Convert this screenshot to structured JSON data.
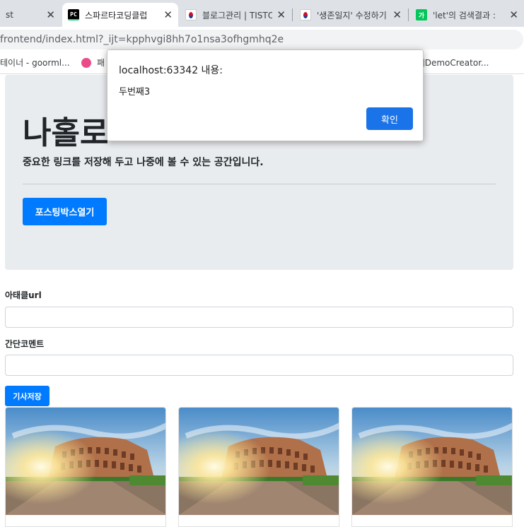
{
  "browser": {
    "tabs": [
      {
        "title": "st"
      },
      {
        "title": "스파르타코딩클럽"
      },
      {
        "title": "블로그관리 | TISTO"
      },
      {
        "title": "'생존일지' 수정하기"
      },
      {
        "title": "'let'의 검색결과 : "
      }
    ],
    "url": "frontend/index.html?_ijt=kpphvgi8hh7o1nsa3ofhgmhq2e",
    "bookmarks": [
      {
        "label": "테이너 - goorml..."
      },
      {
        "label": "패"
      },
      {
        "label": "세]DemoCreator..."
      }
    ]
  },
  "page": {
    "title": "나홀로",
    "lead": "중요한 링크를 저장해 두고 나중에 볼 수 있는 공간입니다.",
    "open_box_button": "포스팅박스열기",
    "url_label": "아태클url",
    "comment_label": "간단코멘트",
    "save_button": "기사저장",
    "url_value": "",
    "comment_value": ""
  },
  "dialog": {
    "title": "localhost:63342 내용:",
    "message": "두번째3",
    "ok_button": "확인"
  },
  "colors": {
    "primary": "#007bff",
    "dialog_button": "#1a73e8",
    "jumbotron": "#e9ecef"
  }
}
